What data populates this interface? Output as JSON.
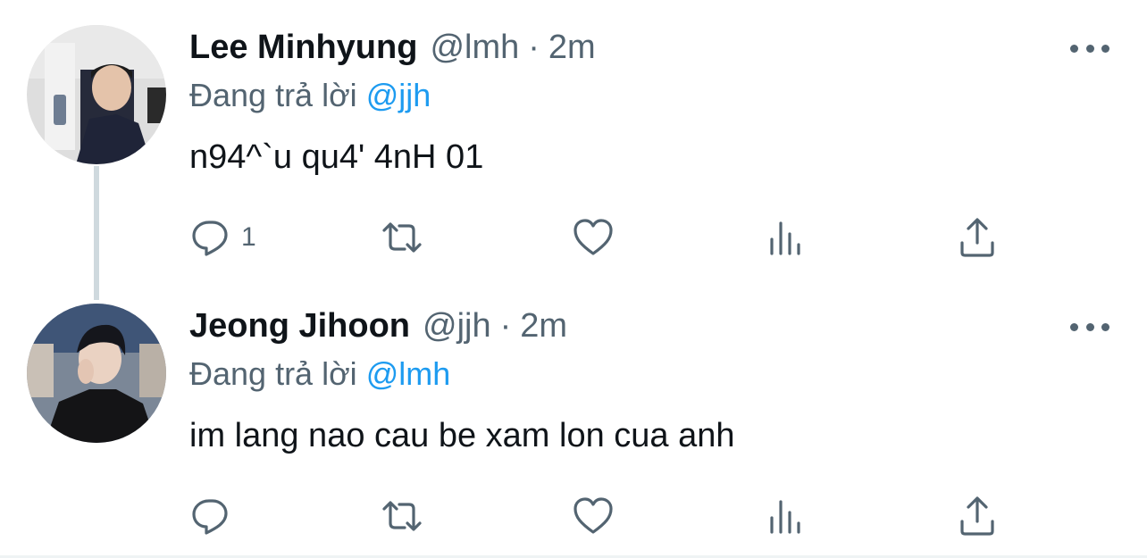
{
  "tweets": [
    {
      "name": "Lee Minhyung",
      "handle": "@lmh",
      "separator": "·",
      "time": "2m",
      "reply_prefix": "Đang trả lời",
      "reply_to": "@jjh",
      "text": "n94^`u qu4' 4nH 01",
      "reply_count": "1"
    },
    {
      "name": "Jeong Jihoon",
      "handle": "@jjh",
      "separator": "·",
      "time": "2m",
      "reply_prefix": "Đang trả lời",
      "reply_to": "@lmh",
      "text": "im lang nao cau be xam lon cua anh",
      "reply_count": ""
    }
  ],
  "colors": {
    "name": "#0f1419",
    "muted": "#536471",
    "mention": "#1d9bf0",
    "thread_line": "#cfd9de"
  },
  "icons": [
    "more-icon",
    "reply-icon",
    "retweet-icon",
    "like-icon",
    "views-icon",
    "share-icon"
  ]
}
